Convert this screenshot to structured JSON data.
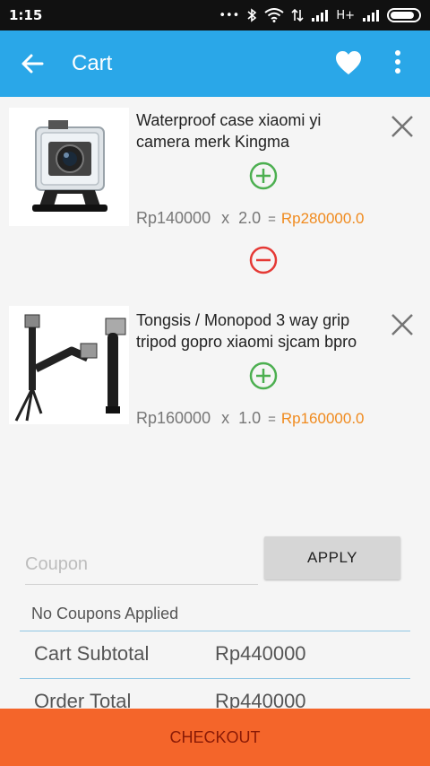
{
  "status_bar": {
    "time": "1:15",
    "signal_text": "H+"
  },
  "app_bar": {
    "title": "Cart"
  },
  "items": [
    {
      "name": "Waterproof case xiaomi yi camera merk Kingma",
      "unit_price": "Rp140000",
      "times": "x",
      "quantity": "2.0",
      "equals": "=",
      "line_total": "Rp280000.0"
    },
    {
      "name": "Tongsis / Monopod 3 way grip tripod gopro xiaomi sjcam bpro",
      "unit_price": "Rp160000",
      "times": "x",
      "quantity": "1.0",
      "equals": "=",
      "line_total": "Rp160000.0"
    }
  ],
  "coupon": {
    "placeholder": "Coupon",
    "apply_label": "APPLY",
    "status": "No Coupons Applied"
  },
  "summary": {
    "subtotal_label": "Cart Subtotal",
    "subtotal_value": "Rp440000",
    "total_label": "Order Total",
    "total_value": "Rp440000"
  },
  "checkout_label": "CHECKOUT",
  "colors": {
    "app_bar": "#2aa7e8",
    "checkout": "#f4652a",
    "price_total": "#f08a1d",
    "add": "#4caf50",
    "remove": "#e53935"
  }
}
